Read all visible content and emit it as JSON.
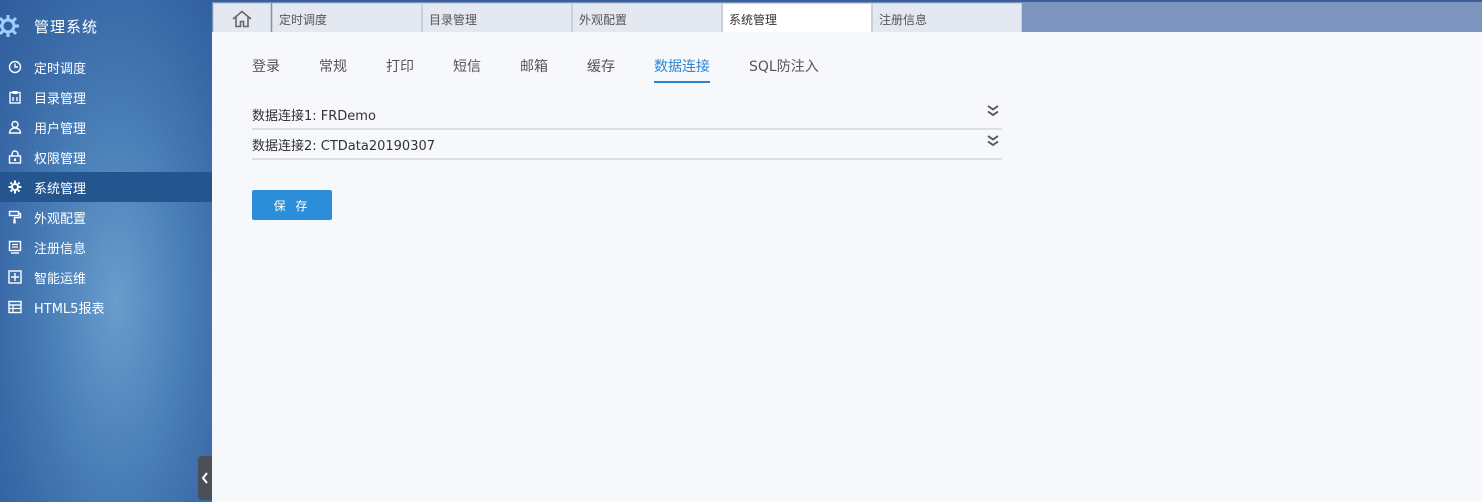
{
  "sidebar": {
    "title": "管理系统",
    "items": [
      {
        "label": "定时调度",
        "icon": "clock-icon"
      },
      {
        "label": "目录管理",
        "icon": "clipboard-icon"
      },
      {
        "label": "用户管理",
        "icon": "user-icon"
      },
      {
        "label": "权限管理",
        "icon": "lock-icon"
      },
      {
        "label": "系统管理",
        "icon": "gear-icon"
      },
      {
        "label": "外观配置",
        "icon": "paint-roller-icon"
      },
      {
        "label": "注册信息",
        "icon": "register-icon"
      },
      {
        "label": "智能运维",
        "icon": "plus-box-icon"
      },
      {
        "label": "HTML5报表",
        "icon": "table-icon"
      }
    ],
    "active_index": 4
  },
  "tabs": {
    "home_icon": "home-icon",
    "items": [
      "定时调度",
      "目录管理",
      "外观配置",
      "系统管理",
      "注册信息"
    ],
    "active": "系统管理"
  },
  "subtabs": {
    "items": [
      "登录",
      "常规",
      "打印",
      "短信",
      "邮箱",
      "缓存",
      "数据连接",
      "SQL防注入"
    ],
    "active": "数据连接"
  },
  "connections": [
    {
      "label": "数据连接1: FRDemo"
    },
    {
      "label": "数据连接2: CTData20190307"
    }
  ],
  "save_label": "保 存",
  "colors": {
    "accent": "#2a85d6",
    "sidebar_active": "#25558f",
    "topbar": "#7c95be"
  }
}
